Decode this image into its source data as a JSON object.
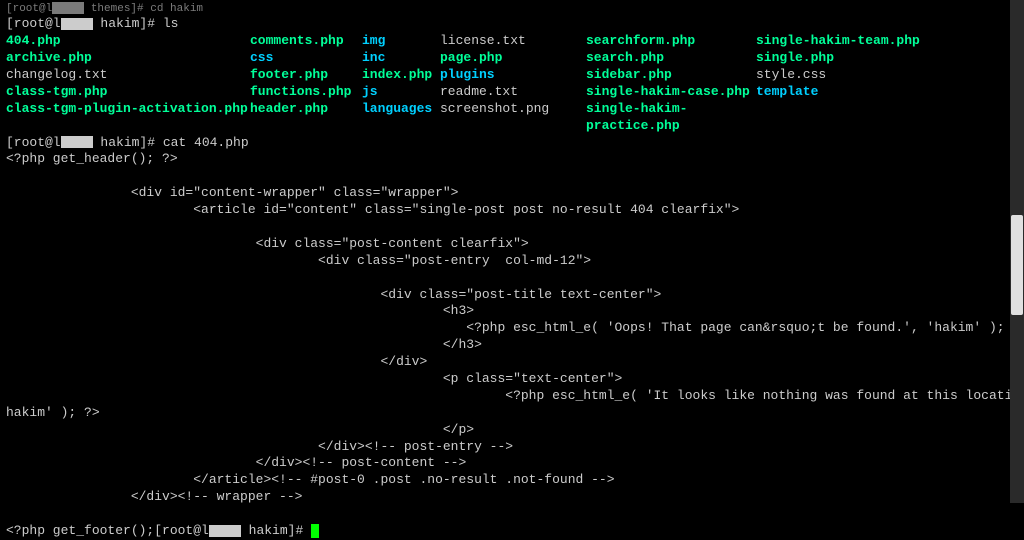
{
  "line0": "[root@l     themes]# cd hakim",
  "prompt1_prefix": "[root@l",
  "prompt1_suffix": " hakim]# ls",
  "ls": {
    "row1": [
      "404.php",
      "comments.php",
      "img",
      "license.txt",
      "searchform.php",
      "single-hakim-team.php"
    ],
    "row2": [
      "archive.php",
      "css",
      "inc",
      "page.php",
      "search.php",
      "single.php"
    ],
    "row3": [
      "changelog.txt",
      "footer.php",
      "index.php",
      "plugins",
      "sidebar.php",
      "style.css"
    ],
    "row4": [
      "class-tgm.php",
      "functions.php",
      "js",
      "readme.txt",
      "single-hakim-case.php",
      "template"
    ],
    "row5": [
      "class-tgm-plugin-activation.php",
      "header.php",
      "languages",
      "screenshot.png",
      "single-hakim-practice.php",
      ""
    ]
  },
  "colors": {
    "row1": [
      "green",
      "green",
      "cyan",
      "white",
      "green",
      "green"
    ],
    "row2": [
      "green",
      "cyan",
      "cyan",
      "green",
      "green",
      "green"
    ],
    "row3": [
      "white",
      "green",
      "green",
      "cyan",
      "green",
      "white"
    ],
    "row4": [
      "green",
      "green",
      "cyan",
      "white",
      "green",
      "cyan"
    ],
    "row5": [
      "green",
      "green",
      "cyan",
      "white",
      "green",
      "white"
    ]
  },
  "prompt2_prefix": "[root@l",
  "prompt2_suffix": " hakim]# cat 404.php",
  "code": {
    "l1": "<?php get_header(); ?>",
    "l3": "                <div id=\"content-wrapper\" class=\"wrapper\">",
    "l4": "                        <article id=\"content\" class=\"single-post post no-result 404 clearfix\">",
    "l6": "                                <div class=\"post-content clearfix\">",
    "l7": "                                        <div class=\"post-entry  col-md-12\">",
    "l9": "                                                <div class=\"post-title text-center\">",
    "l10": "                                                        <h3>",
    "l11": "                                                           <?php esc_html_e( 'Oops! That page can&rsquo;t be found.', 'hakim' ); ?>",
    "l12": "                                                        </h3>",
    "l13": "                                                </div>",
    "l14": "                                                        <p class=\"text-center\">",
    "l15": "                                                                <?php esc_html_e( 'It looks like nothing was found at this location.', '",
    "l15b": "hakim' ); ?>",
    "l16": "                                                        </p>",
    "l17": "                                        </div><!-- post-entry -->",
    "l18": "                                </div><!-- post-content -->",
    "l19": "                        </article><!-- #post-0 .post .no-result .not-found -->",
    "l20": "                </div><!-- wrapper -->"
  },
  "footer_prefix": "<?php get_footer();[root@l",
  "footer_suffix": " hakim]# "
}
